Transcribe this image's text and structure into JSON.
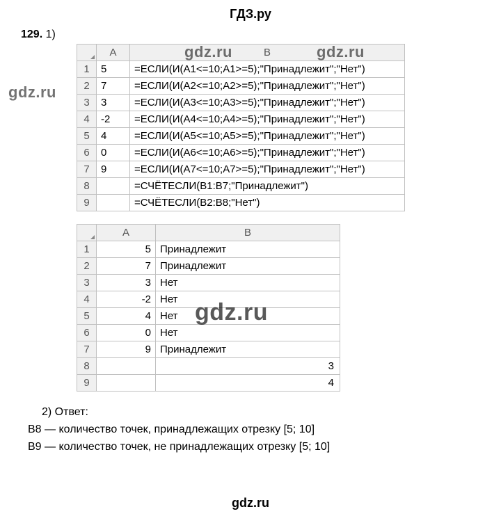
{
  "header": "ГДЗ.ру",
  "footer": "gdz.ru",
  "task": {
    "num": "129.",
    "part1": "1)"
  },
  "watermark": "gdz.ru",
  "table1": {
    "colA_label": "A",
    "colB_label": "B",
    "rows": [
      {
        "r": "1",
        "a": "5",
        "b": "=ЕСЛИ(И(A1<=10;A1>=5);\"Принадлежит\";\"Нет\")"
      },
      {
        "r": "2",
        "a": "7",
        "b": "=ЕСЛИ(И(A2<=10;A2>=5);\"Принадлежит\";\"Нет\")"
      },
      {
        "r": "3",
        "a": "3",
        "b": "=ЕСЛИ(И(A3<=10;A3>=5);\"Принадлежит\";\"Нет\")"
      },
      {
        "r": "4",
        "a": "-2",
        "b": "=ЕСЛИ(И(A4<=10;A4>=5);\"Принадлежит\";\"Нет\")"
      },
      {
        "r": "5",
        "a": "4",
        "b": "=ЕСЛИ(И(A5<=10;A5>=5);\"Принадлежит\";\"Нет\")"
      },
      {
        "r": "6",
        "a": "0",
        "b": "=ЕСЛИ(И(A6<=10;A6>=5);\"Принадлежит\";\"Нет\")"
      },
      {
        "r": "7",
        "a": "9",
        "b": "=ЕСЛИ(И(A7<=10;A7>=5);\"Принадлежит\";\"Нет\")"
      },
      {
        "r": "8",
        "a": "",
        "b": "=СЧЁТЕСЛИ(B1:B7;\"Принадлежит\")"
      },
      {
        "r": "9",
        "a": "",
        "b": "=СЧЁТЕСЛИ(B2:B8;\"Нет\")"
      }
    ]
  },
  "table2": {
    "colA_label": "A",
    "colB_label": "B",
    "rows": [
      {
        "r": "1",
        "a": "5",
        "b": "Принадлежит",
        "num": false
      },
      {
        "r": "2",
        "a": "7",
        "b": "Принадлежит",
        "num": false
      },
      {
        "r": "3",
        "a": "3",
        "b": "Нет",
        "num": false
      },
      {
        "r": "4",
        "a": "-2",
        "b": "Нет",
        "num": false
      },
      {
        "r": "5",
        "a": "4",
        "b": "Нет",
        "num": false
      },
      {
        "r": "6",
        "a": "0",
        "b": "Нет",
        "num": false
      },
      {
        "r": "7",
        "a": "9",
        "b": "Принадлежит",
        "num": false
      },
      {
        "r": "8",
        "a": "",
        "b": "3",
        "num": true
      },
      {
        "r": "9",
        "a": "",
        "b": "4",
        "num": true
      }
    ]
  },
  "answer": {
    "part2": "2) Ответ:",
    "line1": "B8 — количество точек, принадлежащих отрезку [5; 10]",
    "line2": "B9 — количество точек, не принадлежащих отрезку [5; 10]"
  }
}
